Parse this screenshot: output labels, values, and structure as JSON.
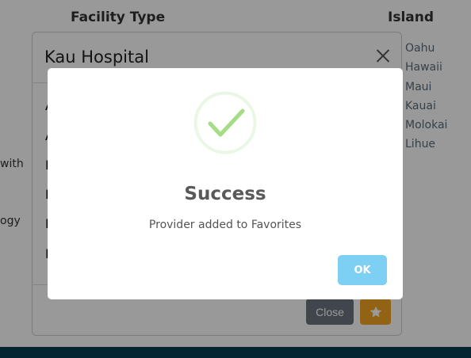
{
  "background": {
    "columns": {
      "facility_type": "Facility Type",
      "island": "Island"
    },
    "islands": [
      "Oahu",
      "Hawaii",
      "Maui",
      "Kauai",
      "Molokai",
      "Lihue"
    ],
    "edge_fragments": [
      "with",
      "ogy"
    ],
    "footer_color": "#0b3f56"
  },
  "detail_modal": {
    "title": "Kau Hospital",
    "row_stubs": [
      "A",
      "A",
      "N",
      "I",
      "P",
      "F"
    ],
    "close_label": "Close",
    "favorite_icon": "star-icon",
    "favorite_color": "#f5a623"
  },
  "alert": {
    "icon": "success-check-icon",
    "icon_color": "#a5dc86",
    "title": "Success",
    "text": "Provider added to Favorites",
    "ok_label": "OK",
    "ok_color": "#7ecff4"
  }
}
